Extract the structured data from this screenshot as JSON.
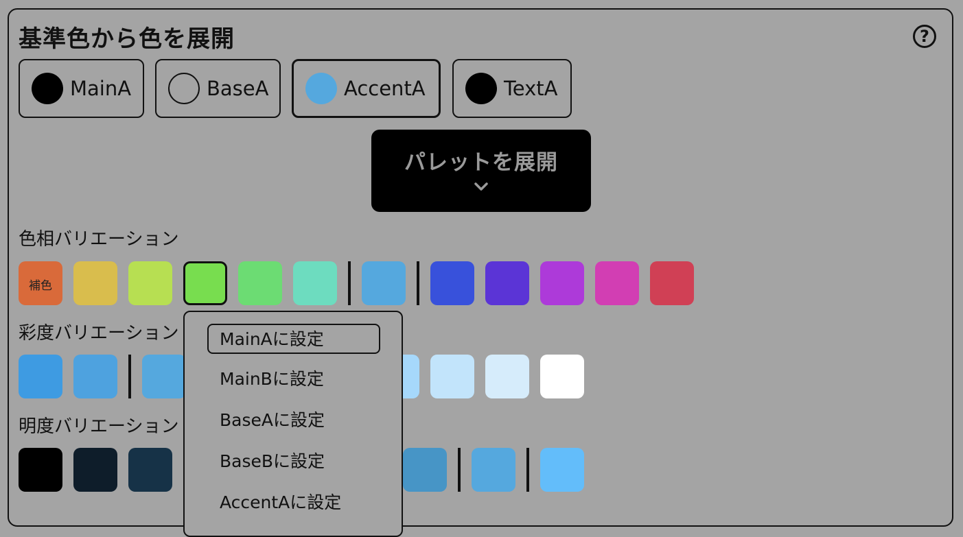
{
  "header": {
    "title": "基準色から色を展開",
    "help_icon": "question-circle-icon"
  },
  "base_colors": [
    {
      "label": "MainA",
      "color": "#000000",
      "active": false
    },
    {
      "label": "BaseA",
      "color": "#a4a4a4",
      "active": false
    },
    {
      "label": "AccentA",
      "color": "#55a8de",
      "active": true
    },
    {
      "label": "TextA",
      "color": "#000000",
      "active": false
    }
  ],
  "expand_button": {
    "label": "パレットを展開",
    "icon": "chevron-down-icon"
  },
  "hue": {
    "label": "色相バリエーション",
    "complement_label": "補色",
    "swatches": [
      "#d96a3a",
      "#d9bd4d",
      "#b7df52",
      "#78dd4f",
      "#6cdc73",
      "#6ddcbf",
      "#55a8de",
      "#3851db",
      "#5b34d6",
      "#ad3ad9",
      "#d23eb3",
      "#d04055"
    ]
  },
  "saturation": {
    "label": "彩度バリエーション",
    "swatches": [
      "#3e9be2",
      "#4ea2df",
      "#55a8de",
      "#a6d8fb",
      "#c2e4fb",
      "#d6ecfb",
      "#ffffff"
    ]
  },
  "lightness": {
    "label": "明度バリエーション",
    "swatches": [
      "#000000",
      "#0e1d2a",
      "#163247",
      "#4795c6",
      "#55a8de",
      "#63bdfa"
    ]
  },
  "context_menu": {
    "items": [
      "MainAに設定",
      "MainBに設定",
      "BaseAに設定",
      "BaseBに設定",
      "AccentAに設定"
    ]
  }
}
